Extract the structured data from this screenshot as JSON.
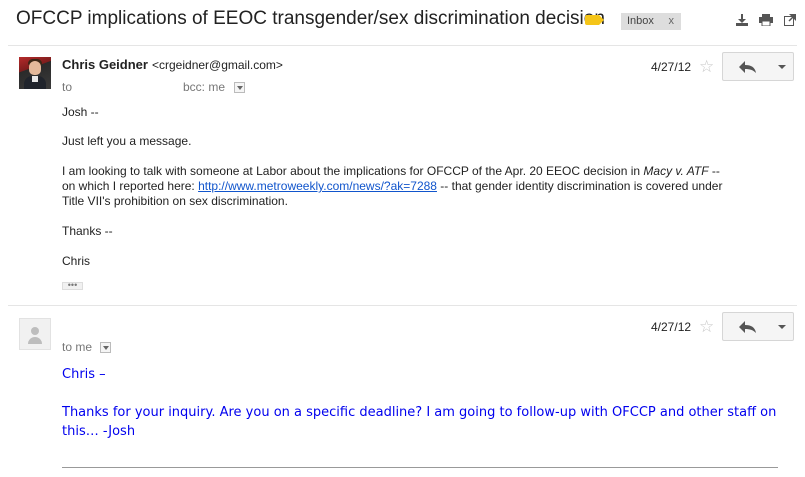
{
  "thread": {
    "subject": "OFCCP implications of EEOC transgender/sex discrimination decision",
    "label_chip": "Inbox",
    "label_chip_close": "x"
  },
  "toolbar": {
    "icons": [
      "download-icon",
      "print-icon",
      "new-window-icon"
    ]
  },
  "messages": [
    {
      "sender_name": "Chris Geidner",
      "sender_email": "<crgeidner@gmail.com>",
      "to_label": "to",
      "bcc_label": "bcc: me",
      "date": "4/27/12",
      "body": {
        "greeting": "Josh --",
        "line1": "Just left you a message.",
        "para_part1": "I am looking to talk with someone at Labor about the implications for OFCCP of the Apr. 20 EEOC decision in ",
        "para_italic": "Macy v. ATF",
        "para_part2": " --",
        "para_line2_pre": "on which I reported here: ",
        "link": "http://www.metroweekly.com/news/?ak=7288",
        "para_line2_post": " -- that gender identity discrimination is covered under",
        "para_line3": "Title VII's prohibition on sex discrimination.",
        "closing": "Thanks --",
        "signature": "Chris",
        "trimmed": "•••"
      }
    },
    {
      "to_label": "to me",
      "date": "4/27/12",
      "body": {
        "greeting": "Chris –",
        "line1": "Thanks for your inquiry.  Are you on a specific deadline?  I am going to follow-up with OFCCP and other staff on",
        "line2": "this…  -Josh"
      }
    }
  ],
  "colors": {
    "label_yellow": "#f5c518",
    "link_blue": "#1155cc",
    "reply_text_blue": "#0000ee"
  }
}
